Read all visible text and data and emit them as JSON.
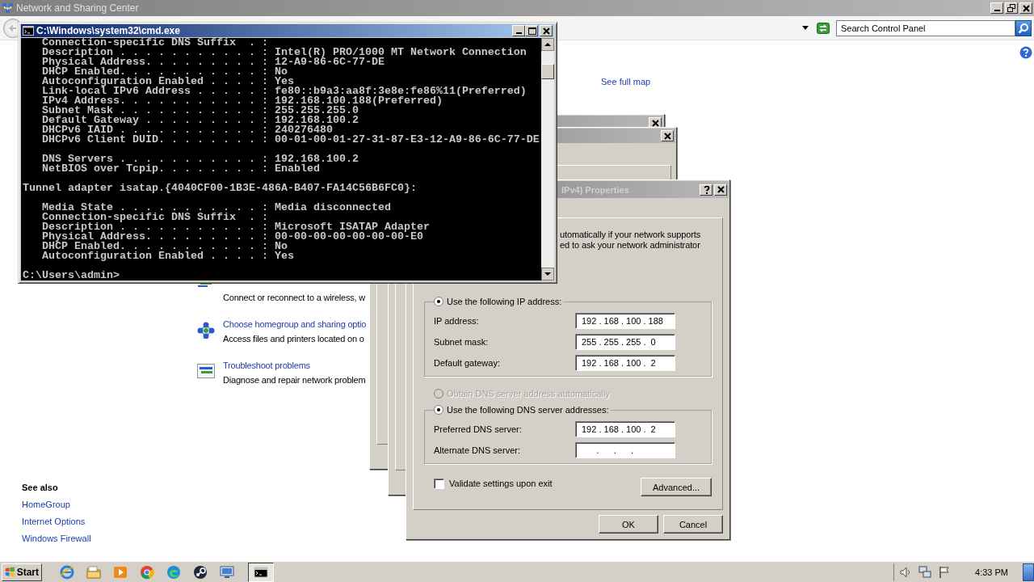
{
  "background_window": {
    "title": "Network and Sharing Center",
    "active": false,
    "search": {
      "placeholder": "Search Control Panel"
    },
    "map_link": "See full map",
    "tasks": [
      {
        "description": "Connect or reconnect to a wireless, w",
        "kind": "connect"
      },
      {
        "title": "Choose homegroup and sharing optio",
        "description": "Access files and printers located on o",
        "kind": "homegroup"
      },
      {
        "title": "Troubleshoot problems",
        "description": "Diagnose and repair network problem",
        "kind": "troubleshoot"
      }
    ],
    "see_also": {
      "heading": "See also",
      "links": [
        "HomeGroup",
        "Internet Options",
        "Windows Firewall"
      ]
    }
  },
  "properties_dialog": {
    "title": "IPv4) Properties",
    "active": false,
    "intro": [
      "utomatically if your network supports",
      "ed to ask your network administrator"
    ],
    "ip_options": [
      {
        "label": "Use the following IP address:",
        "selected": true,
        "disabled": false,
        "fields": [
          {
            "label": "IP address:",
            "value": "192 . 168 . 100 . 188"
          },
          {
            "label": "Subnet mask:",
            "value": "255 . 255 . 255 .  0"
          },
          {
            "label": "Default gateway:",
            "value": "192 . 168 . 100 .  2"
          }
        ]
      }
    ],
    "dns_options": [
      {
        "label": "Obtain DNS server address automatically",
        "selected": false,
        "disabled": true
      },
      {
        "label": "Use the following DNS server addresses:",
        "selected": true,
        "disabled": false,
        "fields": [
          {
            "label": "Preferred DNS server:",
            "value": "192 . 168 . 100 .  2"
          },
          {
            "label": "Alternate DNS server:",
            "value": "      .      .      ."
          }
        ]
      }
    ],
    "validate": {
      "label": "Validate settings upon exit",
      "checked": false
    },
    "advanced_button": "Advanced...",
    "buttons": [
      "OK",
      "Cancel"
    ]
  },
  "cmd_window": {
    "title": "C:\\Windows\\system32\\cmd.exe",
    "active": true,
    "blocks": [
      {
        "lines": [
          "   Connection-specific DNS Suffix  . :",
          "   Description . . . . . . . . . . . : Intel(R) PRO/1000 MT Network Connection",
          "   Physical Address. . . . . . . . . : 12-A9-86-6C-77-DE",
          "   DHCP Enabled. . . . . . . . . . . : No",
          "   Autoconfiguration Enabled . . . . : Yes",
          "   Link-local IPv6 Address . . . . . : fe80::b9a3:aa8f:3e8e:fe86%11(Preferred)",
          "   IPv4 Address. . . . . . . . . . . : 192.168.100.188(Preferred)",
          "   Subnet Mask . . . . . . . . . . . : 255.255.255.0",
          "   Default Gateway . . . . . . . . . : 192.168.100.2",
          "   DHCPv6 IAID . . . . . . . . . . . : 240276480",
          "   DHCPv6 Client DUID. . . . . . . . : 00-01-00-01-27-31-87-E3-12-A9-86-6C-77-DE"
        ]
      },
      {
        "lines": [
          "   DNS Servers . . . . . . . . . . . : 192.168.100.2",
          "   NetBIOS over Tcpip. . . . . . . . : Enabled"
        ]
      },
      {
        "lines": [
          "Tunnel adapter isatap.{4040CF00-1B3E-486A-B407-FA14C56B6FC0}:"
        ]
      },
      {
        "lines": [
          "   Media State . . . . . . . . . . . : Media disconnected",
          "   Connection-specific DNS Suffix  . :",
          "   Description . . . . . . . . . . . : Microsoft ISATAP Adapter",
          "   Physical Address. . . . . . . . . : 00-00-00-00-00-00-00-E0",
          "   DHCP Enabled. . . . . . . . . . . : No",
          "   Autoconfiguration Enabled . . . . : Yes"
        ]
      },
      {
        "lines": [
          "C:\\Users\\admin>"
        ]
      }
    ]
  },
  "taskbar": {
    "start": "Start",
    "apps": [
      {
        "kind": "ie",
        "selected": false
      },
      {
        "kind": "folder",
        "selected": false
      },
      {
        "kind": "media",
        "selected": false
      },
      {
        "kind": "chrome",
        "selected": false
      },
      {
        "kind": "edge",
        "selected": false
      },
      {
        "kind": "steam",
        "selected": false
      },
      {
        "kind": "network",
        "selected": false
      },
      {
        "kind": "console",
        "selected": true
      }
    ],
    "clock": "4:33 PM"
  }
}
